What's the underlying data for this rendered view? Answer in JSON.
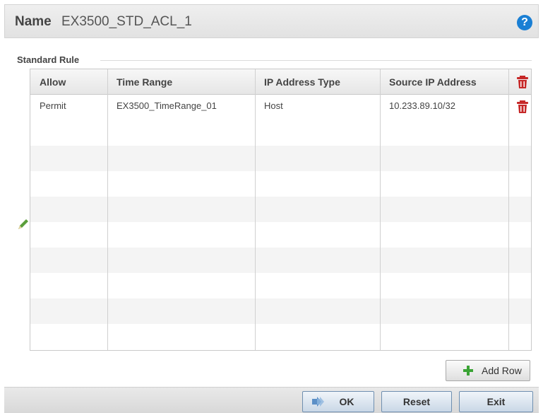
{
  "header": {
    "name_label": "Name",
    "name_value": "EX3500_STD_ACL_1",
    "help_glyph": "?"
  },
  "section": {
    "title": "Standard Rule"
  },
  "table": {
    "columns": [
      "Allow",
      "Time Range",
      "IP Address Type",
      "Source IP Address"
    ],
    "rows": [
      {
        "allow": "Permit",
        "time_range": "EX3500_TimeRange_01",
        "ip_type": "Host",
        "source_ip": "10.233.89.10/32"
      }
    ]
  },
  "buttons": {
    "add_row": "Add Row",
    "ok": "OK",
    "reset": "Reset",
    "exit": "Exit"
  },
  "icons": {
    "help": "help-icon",
    "trash": "trash-icon",
    "edit": "pencil-icon",
    "add": "plus-icon",
    "ok": "arrow-icon"
  },
  "colors": {
    "help_blue": "#1a7fd4",
    "trash_red": "#c62828",
    "plus_green": "#3aa335"
  }
}
